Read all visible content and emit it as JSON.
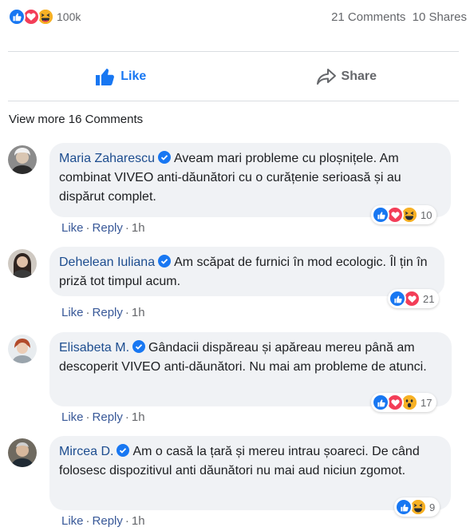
{
  "post_stats": {
    "reaction_count": "100k",
    "comments": "21 Comments",
    "shares": "10 Shares",
    "reaction_icons": [
      "like-icon",
      "love-icon",
      "haha-icon"
    ]
  },
  "actions": {
    "like_label": "Like",
    "share_label": "Share"
  },
  "view_more": "View more 16 Comments",
  "colors": {
    "facebook_blue": "#1877f2",
    "love_red": "#f33e58",
    "haha_yellow": "#f7b125",
    "author_blue": "#1d4d8f",
    "bubble_bg": "#f0f2f5"
  },
  "comments": [
    {
      "author": "Maria Zaharescu",
      "text": "Aveam mari probleme cu ploșnițele. Am combinat VIVEO anti-dăunători cu o curățenie serioasă și au dispărut complet.",
      "reaction_count": "10",
      "reaction_icons": [
        "like-icon",
        "love-icon",
        "haha-icon"
      ],
      "like": "Like",
      "reply": "Reply",
      "time": "1h"
    },
    {
      "author": "Dehelean Iuliana",
      "text": "Am scăpat de furnici în mod ecologic. Îl țin în priză tot timpul acum.",
      "reaction_count": "21",
      "reaction_icons": [
        "like-icon",
        "love-icon"
      ],
      "like": "Like",
      "reply": "Reply",
      "time": "1h"
    },
    {
      "author": "Elisabeta M.",
      "text": "Gândacii dispăreau și apăreau mereu până am descoperit VIVEO anti-dăunători. Nu mai am probleme de atunci.",
      "reaction_count": "17",
      "reaction_icons": [
        "like-icon",
        "love-icon",
        "wow-icon"
      ],
      "like": "Like",
      "reply": "Reply",
      "time": "1h"
    },
    {
      "author": "Mircea D.",
      "text": "Am o casă la țară și mereu intrau șoareci. De când folosesc dispozitivul anti dăunători nu mai aud niciun zgomot.",
      "reaction_count": "9",
      "reaction_icons": [
        "like-icon",
        "haha-icon"
      ],
      "like": "Like",
      "reply": "Reply",
      "time": "1h"
    }
  ]
}
